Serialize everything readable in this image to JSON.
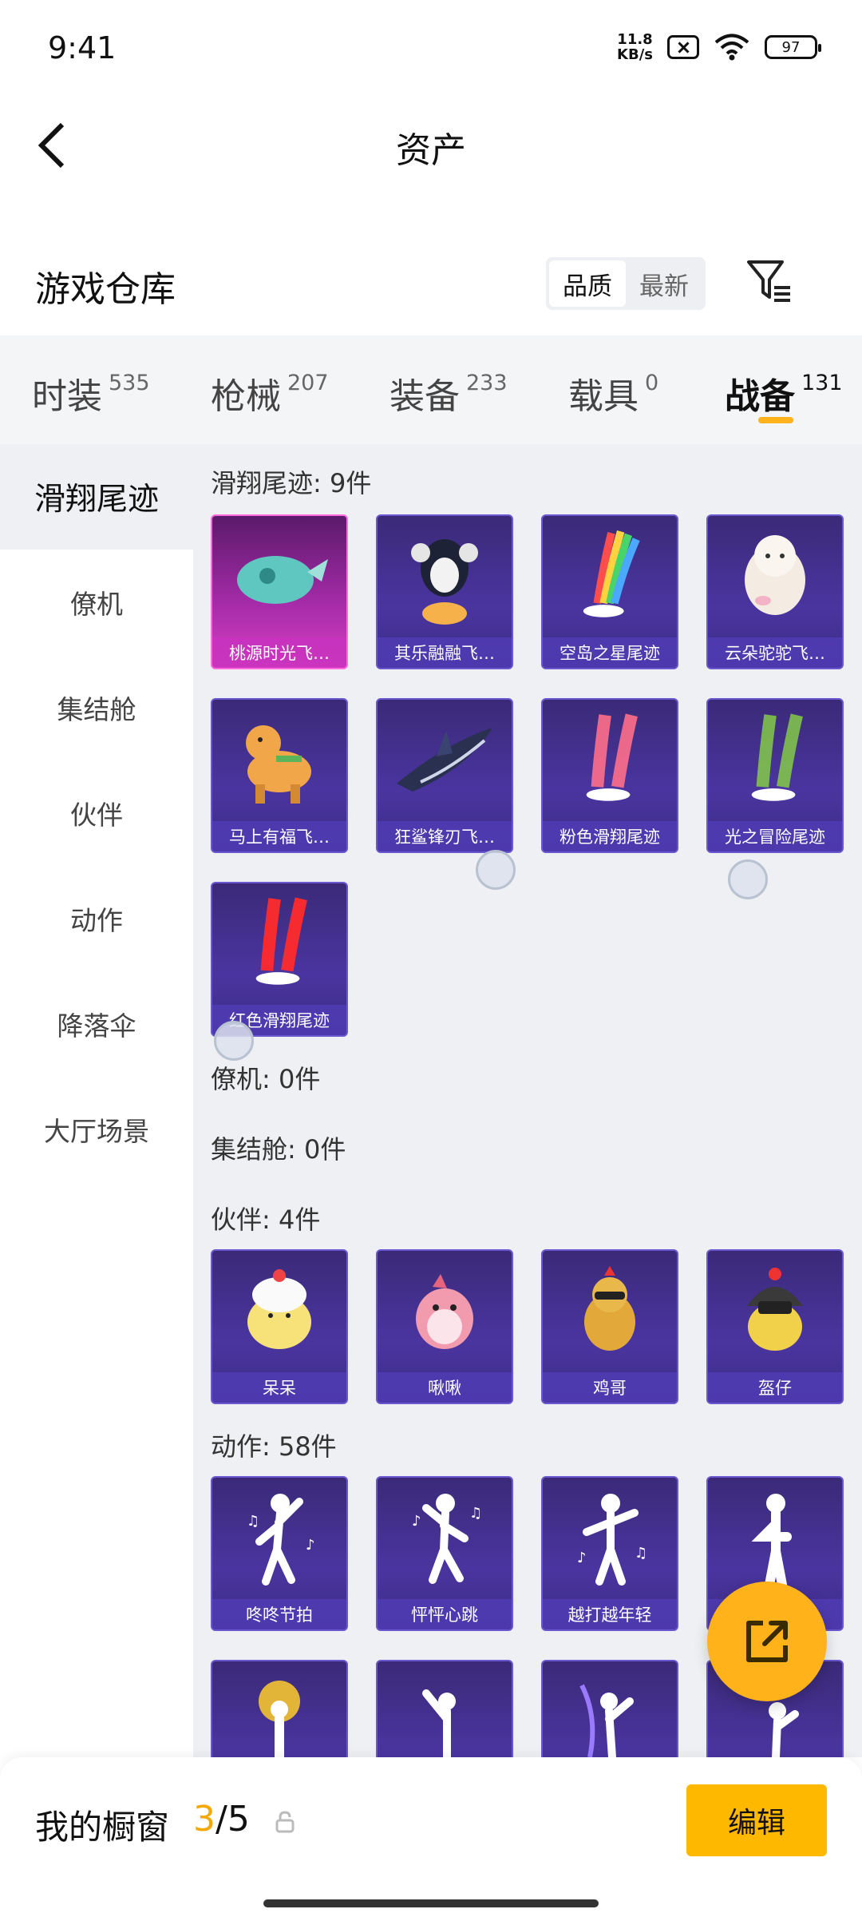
{
  "status": {
    "time": "9:41",
    "net_speed_value": "11.8",
    "net_speed_unit": "KB/s",
    "battery": "97"
  },
  "header": {
    "title": "资产"
  },
  "warehouse": {
    "title": "游戏仓库",
    "sort_quality": "品质",
    "sort_newest": "最新"
  },
  "categories": [
    {
      "name": "时装",
      "count": "535"
    },
    {
      "name": "枪械",
      "count": "207"
    },
    {
      "name": "装备",
      "count": "233"
    },
    {
      "name": "载具",
      "count": "0"
    },
    {
      "name": "战备",
      "count": "131"
    }
  ],
  "sidebar": [
    {
      "label": "滑翔尾迹"
    },
    {
      "label": "僚机"
    },
    {
      "label": "集结舱"
    },
    {
      "label": "伙伴"
    },
    {
      "label": "动作"
    },
    {
      "label": "降落伞"
    },
    {
      "label": "大厅场景"
    }
  ],
  "sections": {
    "glide": {
      "title": "滑翔尾迹: 9件",
      "items": [
        "桃源时光飞…",
        "其乐融融飞…",
        "空岛之星尾迹",
        "云朵驼驼飞…",
        "马上有福飞…",
        "狂鲨锋刃飞…",
        "粉色滑翔尾迹",
        "光之冒险尾迹",
        "红色滑翔尾迹"
      ]
    },
    "wingman": {
      "title": "僚机: 0件"
    },
    "pod": {
      "title": "集结舱: 0件"
    },
    "partner": {
      "title": "伙伴: 4件",
      "items": [
        "呆呆",
        "啾啾",
        "鸡哥",
        "盔仔"
      ]
    },
    "emote": {
      "title": "动作: 58件",
      "items": [
        "咚咚节拍",
        "怦怦心跳",
        "越打越年轻",
        ""
      ]
    }
  },
  "bottom": {
    "showcase_label": "我的橱窗",
    "current": "3",
    "separator": "/",
    "total": "5",
    "edit": "编辑"
  },
  "colors": {
    "accent": "#ffb21a",
    "card": "#4a35a0",
    "card_highlight": "#d63fc4"
  }
}
